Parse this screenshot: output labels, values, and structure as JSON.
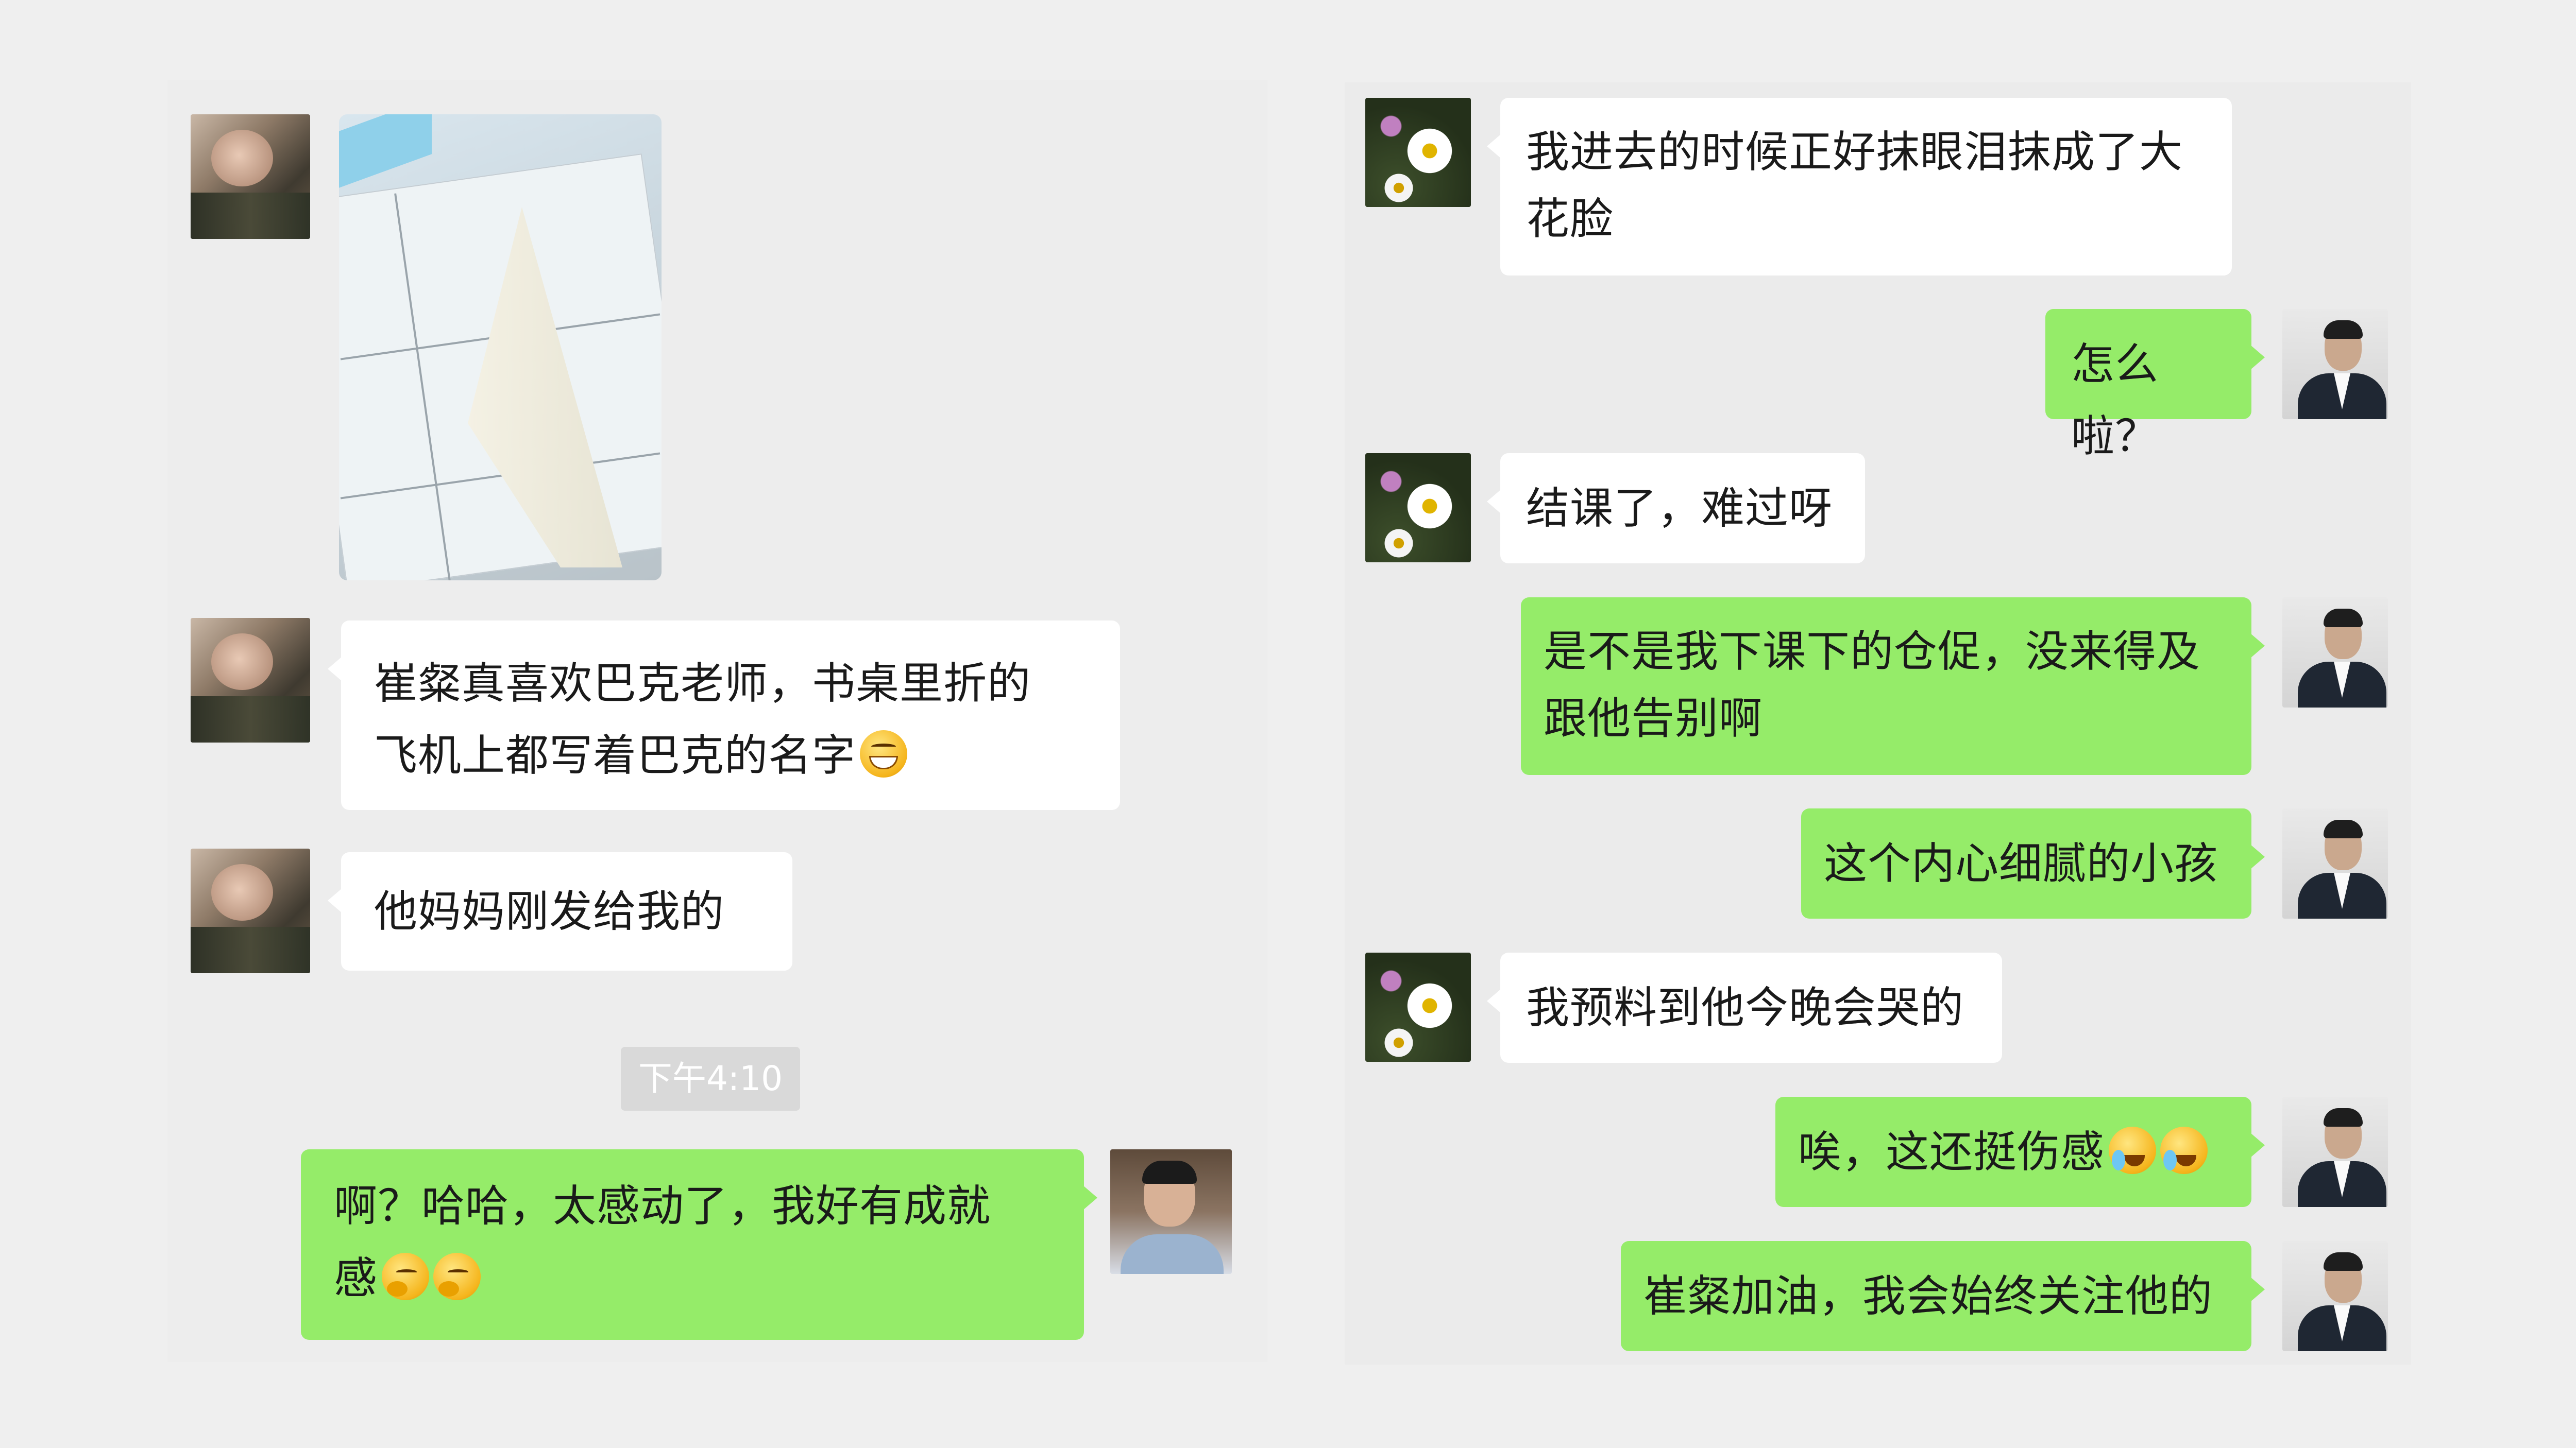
{
  "left_chat": {
    "messages": [
      {
        "sender": "contact",
        "type": "image"
      },
      {
        "sender": "contact",
        "type": "text",
        "line1": "崔粲真喜欢巴克老师，书桌里折的",
        "line2": "飞机上都写着巴克的名字",
        "emoji": "grinning-face"
      },
      {
        "sender": "contact",
        "type": "text",
        "text": "他妈妈刚发给我的"
      },
      {
        "sender": "me",
        "type": "text",
        "line1": "啊？哈哈，太感动了，我好有成就",
        "line2": "感",
        "emoji": [
          "thinking-face",
          "thinking-face"
        ]
      }
    ],
    "timestamp": "下午4:10"
  },
  "right_chat": {
    "messages": [
      {
        "sender": "contact",
        "type": "text",
        "line1": "我进去的时候正好抹眼泪抹成了大",
        "line2": "花脸"
      },
      {
        "sender": "me",
        "type": "text",
        "text": "怎么啦？"
      },
      {
        "sender": "contact",
        "type": "text",
        "text": "结课了，难过呀"
      },
      {
        "sender": "me",
        "type": "text",
        "line1": "是不是我下课下的仓促，没来得及",
        "line2": "跟他告别啊"
      },
      {
        "sender": "me",
        "type": "text",
        "text": "这个内心细腻的小孩"
      },
      {
        "sender": "contact",
        "type": "text",
        "text": "我预料到他今晚会哭的"
      },
      {
        "sender": "me",
        "type": "text",
        "text": "唉，这还挺伤感",
        "emoji": [
          "crying-laughing-face",
          "crying-laughing-face"
        ]
      },
      {
        "sender": "me",
        "type": "text",
        "text": "崔粲加油，我会始终关注他的"
      }
    ]
  },
  "colors": {
    "incoming_bubble": "#ffffff",
    "outgoing_bubble": "#95ec69",
    "background": "#ededed",
    "timestamp_badge": "#d9d9d9"
  }
}
